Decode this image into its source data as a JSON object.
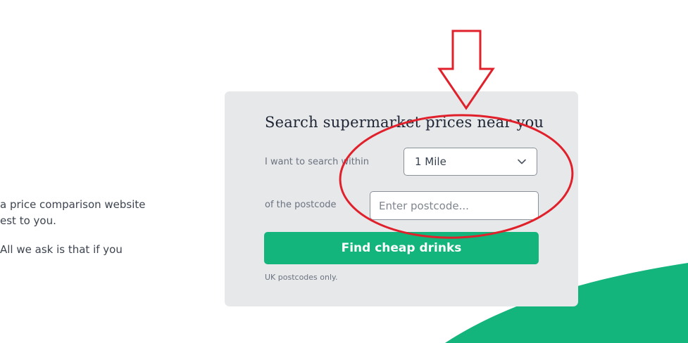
{
  "intro": {
    "line1": "a price comparison website",
    "line2": "est to you.",
    "line3": "All we ask is that if you"
  },
  "search_card": {
    "title": "Search supermarket prices near you",
    "radius_label": "I want to search within",
    "radius_selected": "1 Mile",
    "postcode_label": "of the postcode",
    "postcode_placeholder": "Enter postcode...",
    "postcode_value": "",
    "submit_label": "Find cheap drinks",
    "hint": "UK postcodes only."
  },
  "colors": {
    "accent": "#13b57d",
    "card_background": "#e7e8ea",
    "annotation": "#e0202a"
  },
  "icons": {
    "select_chevron": "chevron-down-icon",
    "annotation_arrow": "down-arrow-icon",
    "annotation_circle": "ellipse-highlight"
  }
}
